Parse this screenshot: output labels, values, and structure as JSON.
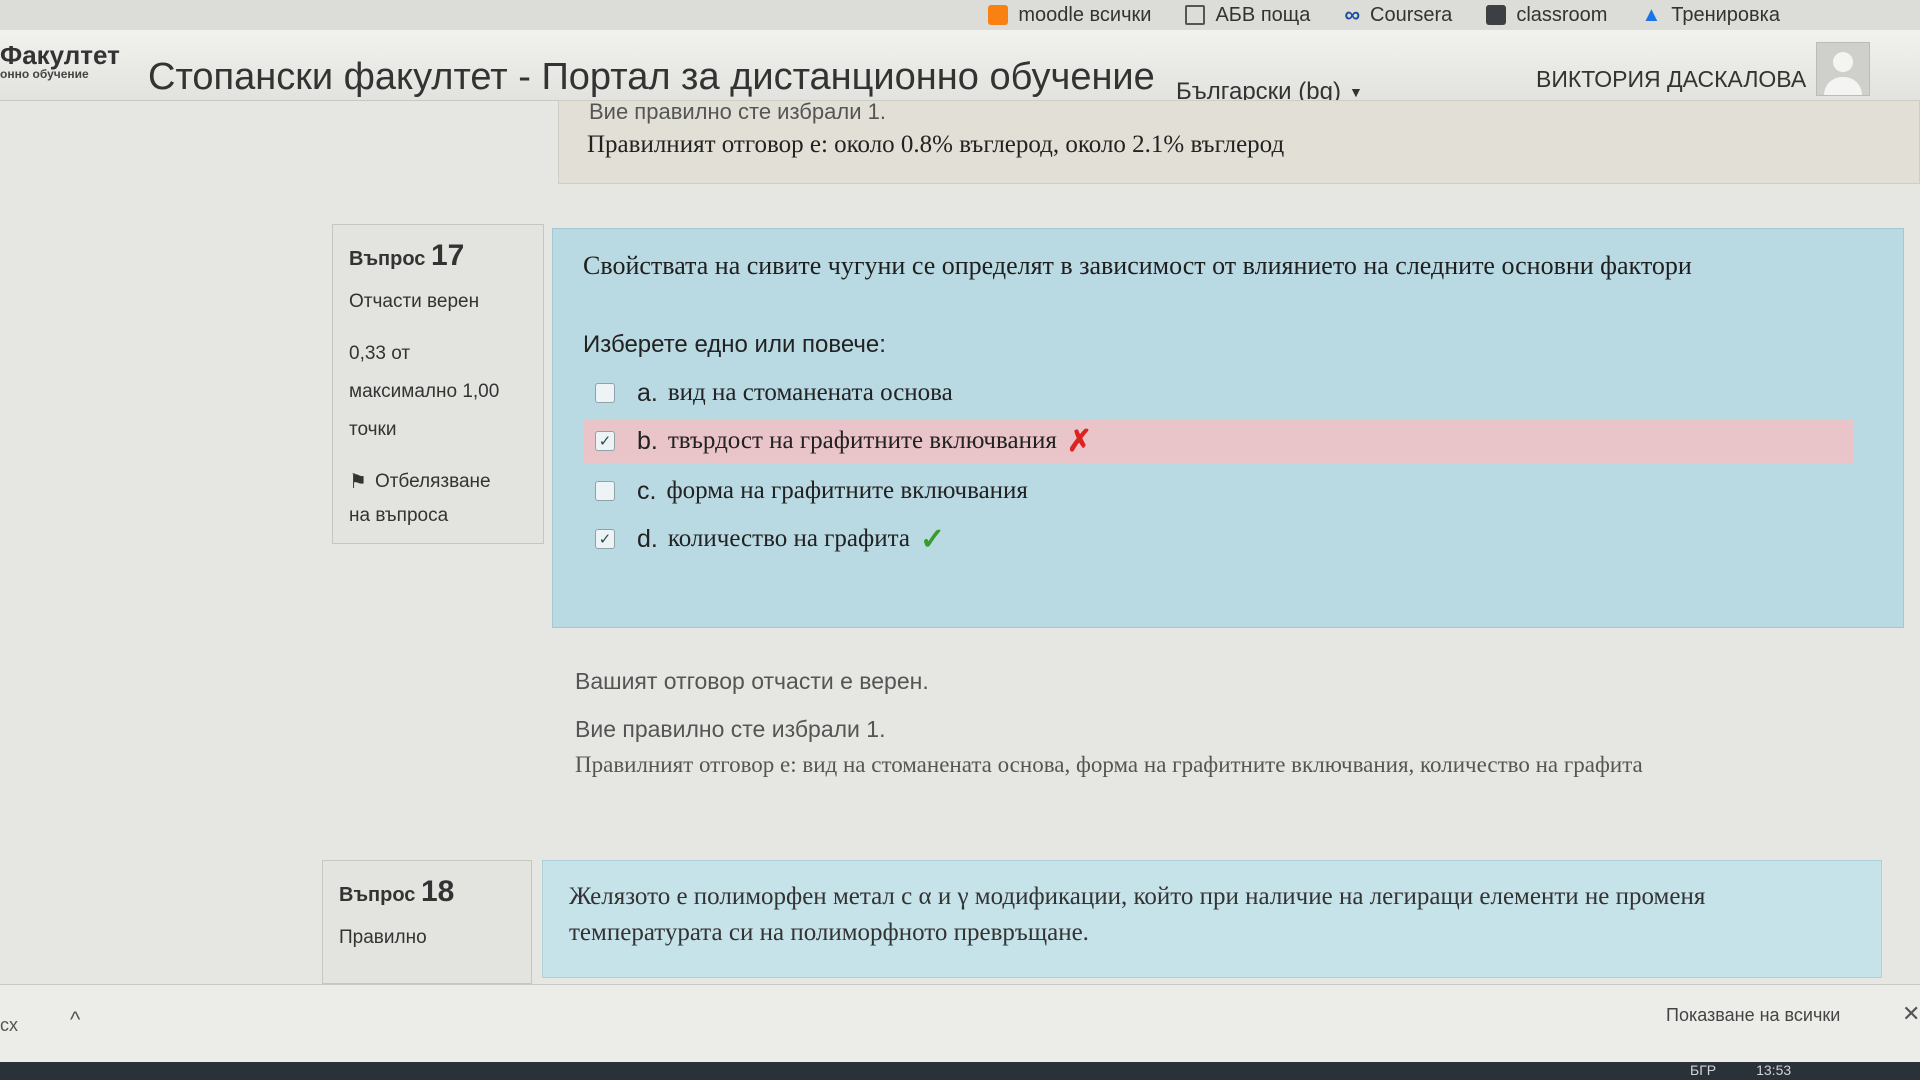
{
  "bookmarks": [
    {
      "label": "АБВ поща",
      "icon": "house-icon",
      "color": "#555"
    },
    {
      "label": "Coursera",
      "icon": "infinity-icon",
      "color": "#1b4fa0"
    },
    {
      "label": "classroom",
      "icon": "classroom-icon",
      "color": "#333"
    },
    {
      "label": "Тренировка",
      "icon": "drive-icon",
      "color": "#1a73e8"
    }
  ],
  "bookmarks_partial": [
    {
      "label": "moodle всички",
      "icon": "moodle-icon",
      "color": "#f98012"
    }
  ],
  "header": {
    "brand_main": "Факултет",
    "brand_sub": "онно обучение",
    "site_title": "Стопански факултет - Портал за дистанционно обучение",
    "language": "Български (bg)",
    "user_name": "ВИКТОРИЯ ДАСКАЛОВА"
  },
  "previous_feedback": {
    "partial_line": "Вие правилно сте избрали 1.",
    "correct_answer": "Правилният отговор е: около 0.8% въглерод, около 2.1% въглерод"
  },
  "question17": {
    "label": "Въпрос",
    "number": "17",
    "state": "Отчасти верен",
    "grade_line1": "0,33 от",
    "grade_line2": "максимално 1,00",
    "grade_line3": "точки",
    "flag_line1": "Отбелязване",
    "flag_line2": "на въпроса",
    "text": "Свойствата на сивите чугуни се определят в зависимост от влиянието на следните основни фактори",
    "prompt": "Изберете едно или повече:",
    "answers": [
      {
        "letter": "a.",
        "text": "вид  на стоманената основа",
        "checked": false,
        "mark": ""
      },
      {
        "letter": "b.",
        "text": "твърдост на графитните включвания",
        "checked": true,
        "mark": "✗"
      },
      {
        "letter": "c.",
        "text": "форма на графитните включвания",
        "checked": false,
        "mark": ""
      },
      {
        "letter": "d.",
        "text": "количество на графита",
        "checked": true,
        "mark": "✓"
      }
    ],
    "feedback_partial": "Вашият отговор отчасти е верен.",
    "feedback_count": "Вие правилно сте избрали 1.",
    "feedback_correct": "Правилният отговор е: вид  на стоманената основа, форма на графитните включвания, количество на графита"
  },
  "question18": {
    "label": "Въпрос",
    "number": "18",
    "state": "Правилно",
    "text": "Желязото е полиморфен метал с α и γ модификации, който при наличие на легиращи елементи не променя температурата си на полиморфното превръщане."
  },
  "downloads": {
    "left": "сх",
    "show_all": "Показване на всички"
  },
  "taskbar": {
    "lang": "БГР",
    "time": "13:53"
  }
}
